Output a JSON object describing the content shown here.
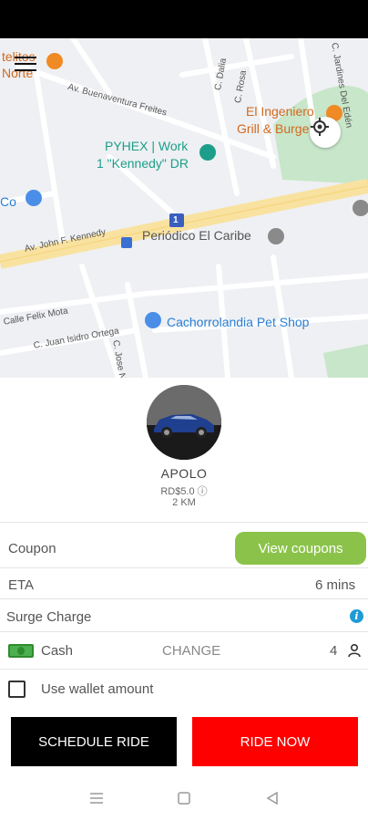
{
  "map": {
    "pois": {
      "castelitos": "telitos",
      "castelitos_line2": "Norte",
      "el_ingeniero": "El Ingeniero",
      "el_ingeniero_line2": "Grill & Burge",
      "pyhex": "PYHEX | Work",
      "pyhex_line2": "1 \"Kennedy\" DR",
      "co": "Co",
      "periodico": "Periódico El Caribe",
      "cachorrolandia": "Cachorrolandia Pet Shop"
    },
    "streets": {
      "buenaventura": "Av. Buenaventura Freites",
      "kennedy": "Av. John F. Kennedy",
      "felix_mota": "Calle Felix Mota",
      "juan_isidro": "C. Juan Isidro Ortega",
      "c_jose": "C. Jose N",
      "c_dalia": "C. Dalia",
      "c_rosa": "C. Rosa",
      "jardines": "C. Jardines Del Edén"
    },
    "highway_shield": "1"
  },
  "vehicle": {
    "name": "APOLO",
    "price": "RD$5.0 ⓘ",
    "distance": "2 KM"
  },
  "rows": {
    "coupon_label": "Coupon",
    "coupon_button": "View coupons",
    "eta_label": "ETA",
    "eta_value": "6 mins",
    "surge_label": "Surge Charge",
    "payment_label": "Cash",
    "change_label": "CHANGE",
    "passengers": "4",
    "wallet_label": "Use wallet amount"
  },
  "actions": {
    "schedule": "SCHEDULE RIDE",
    "ride_now": "RIDE NOW"
  },
  "colors": {
    "coupon_button": "#8bc34a",
    "ride_now": "#ff0000",
    "schedule": "#000000",
    "info": "#1e9ad6"
  }
}
